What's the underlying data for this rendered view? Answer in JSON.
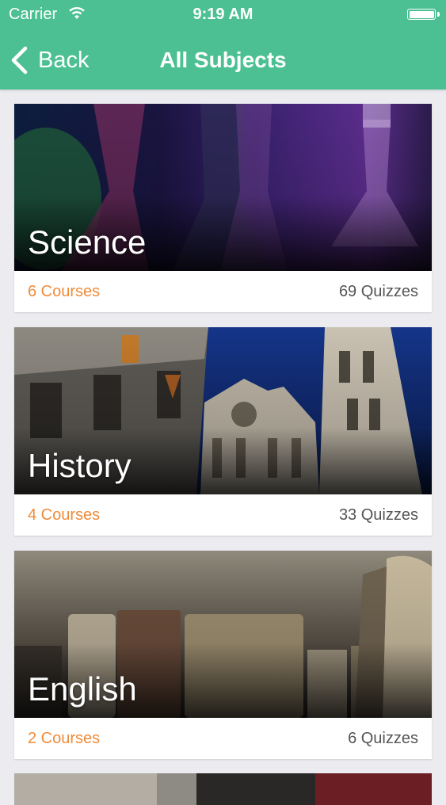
{
  "status_bar": {
    "carrier": "Carrier",
    "time": "9:19 AM"
  },
  "nav": {
    "back_label": "Back",
    "title": "All Subjects"
  },
  "colors": {
    "accent": "#4cc093",
    "courses": "#ef8c3b"
  },
  "subjects": [
    {
      "title": "Science",
      "courses": "6 Courses",
      "quizzes": "69 Quizzes"
    },
    {
      "title": "History",
      "courses": "4 Courses",
      "quizzes": "33 Quizzes"
    },
    {
      "title": "English",
      "courses": "2 Courses",
      "quizzes": "6 Quizzes"
    }
  ]
}
